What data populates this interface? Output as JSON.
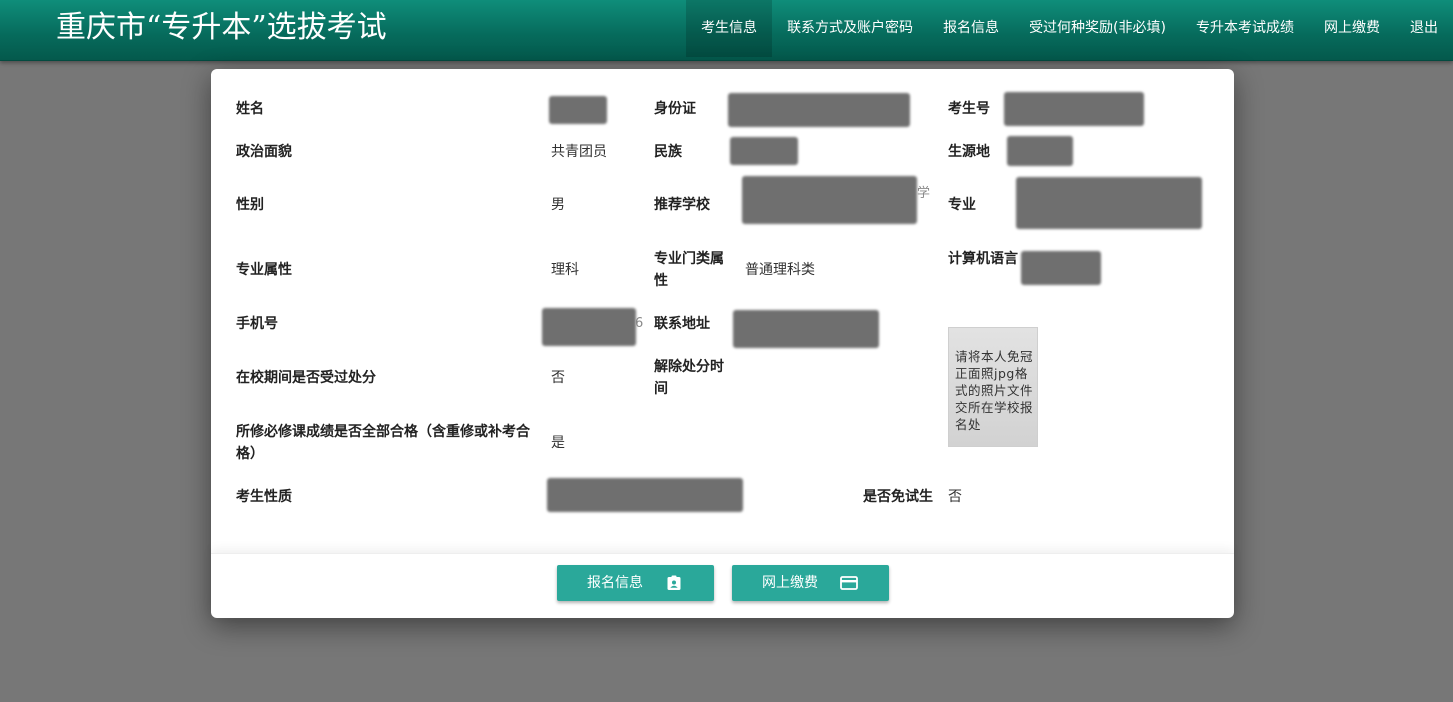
{
  "header": {
    "title": "重庆市“专升本”选拔考试",
    "nav": [
      "考生信息",
      "联系方式及账户密码",
      "报名信息",
      "受过何种奖励(非必填)",
      "专升本考试成绩",
      "网上缴费",
      "退出"
    ]
  },
  "form": {
    "name_label": "姓名",
    "id_label": "身份证",
    "exam_no_label": "考生号",
    "political_label": "政治面貌",
    "political_value": "共青团员",
    "ethnic_label": "民族",
    "origin_label": "生源地",
    "gender_label": "性别",
    "gender_value": "男",
    "school_label": "推荐学校",
    "school_fragment": "学",
    "major_label": "专业",
    "major_attr_label": "专业属性",
    "major_attr_value": "理科",
    "major_cat_label": "专业门类属性",
    "major_cat_value": "普通理科类",
    "computer_lang_label": "计算机语言",
    "phone_label": "手机号",
    "phone_fragment": "6",
    "address_label": "联系地址",
    "punished_label": "在校期间是否受过处分",
    "punished_value": "否",
    "release_label": "解除处分时间",
    "required_pass_label": "所修必修课成绩是否全部合格（含重修或补考合格）",
    "required_pass_value": "是",
    "candidate_type_label": "考生性质",
    "exempt_label": "是否免试生",
    "exempt_value": "否"
  },
  "photo": {
    "hint": "请将本人免冠正面照jpg格式的照片文件交所在学校报名处"
  },
  "footer": {
    "signup_label": "报名信息",
    "signup_icon": "id-badge-icon",
    "pay_label": "网上缴费",
    "pay_icon": "credit-card-icon"
  },
  "colors": {
    "header": "#0a7a68",
    "button": "#2aa89a",
    "backdrop": "#777777"
  }
}
